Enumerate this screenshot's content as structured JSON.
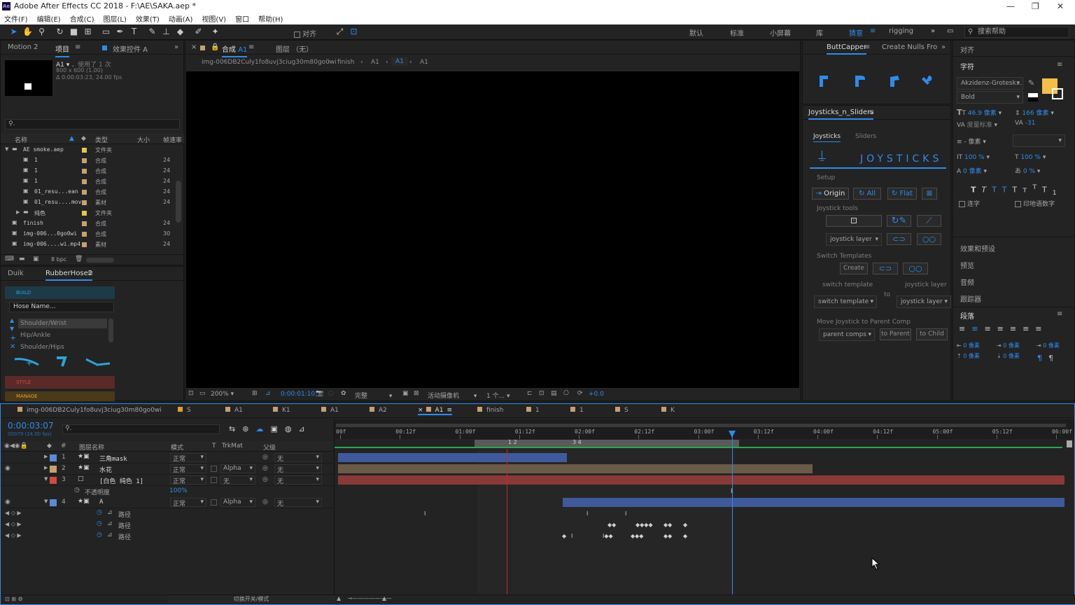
{
  "titlebar": {
    "title": "Adobe After Effects CC 2018 - F:\\AE\\SAKA.aep *",
    "logo": "Ae"
  },
  "menu": [
    "文件(F)",
    "编辑(E)",
    "合成(C)",
    "图层(L)",
    "效果(T)",
    "动画(A)",
    "视图(V)",
    "窗口",
    "帮助(H)"
  ],
  "toolbar": {
    "align_label": "对齐",
    "workspaces": [
      "默认",
      "标准",
      "小屏幕",
      "库",
      "猜意",
      "rigging"
    ],
    "active_workspace": "猜意",
    "search_placeholder": "搜索帮助"
  },
  "project": {
    "tabs": [
      "Motion 2",
      "项目",
      "效果控件 A"
    ],
    "comp_name": "A1",
    "used": "，使用了 1 次",
    "size": "800 x 600 (1.00)",
    "duration": "Δ 0:00:03:23, 24.00 fps",
    "columns": [
      "名称",
      "类型",
      "大小",
      "帧速率"
    ],
    "rows": [
      {
        "name": "AE smoke.aep",
        "type": "文件夹",
        "fps": "",
        "color": "#e0c84a",
        "indent": 0
      },
      {
        "name": "1",
        "type": "合成",
        "fps": "24",
        "color": "#c8a070",
        "indent": 1
      },
      {
        "name": "1",
        "type": "合成",
        "fps": "24",
        "color": "#c8a070",
        "indent": 1
      },
      {
        "name": "1",
        "type": "合成",
        "fps": "24",
        "color": "#c8a070",
        "indent": 1
      },
      {
        "name": "01_resu...ean",
        "type": "合成",
        "fps": "24",
        "color": "#c8a070",
        "indent": 1
      },
      {
        "name": "01_resu....mov",
        "type": "素材",
        "fps": "24",
        "color": "#c8a070",
        "indent": 1
      },
      {
        "name": "纯色",
        "type": "文件夹",
        "fps": "",
        "color": "#e0c84a",
        "indent": 1
      },
      {
        "name": "finish",
        "type": "合成",
        "fps": "24",
        "color": "#c8a070",
        "indent": 0
      },
      {
        "name": "img-006...0go0wi",
        "type": "合成",
        "fps": "30",
        "color": "#c8a070",
        "indent": 0
      },
      {
        "name": "img-006....wi.mp4",
        "type": "素材",
        "fps": "24",
        "color": "#c8a070",
        "indent": 0
      }
    ],
    "bpc": "8 bpc"
  },
  "rubberhose": {
    "tabs": [
      "Duik",
      "RubberHose2"
    ],
    "build": "BUILD",
    "hose_name": "Hose Name...",
    "items": [
      "Shoulder/Wrist",
      "Hip/Ankle",
      "Shoulder/Hips"
    ],
    "style": "STYLE",
    "manage": "MANAGE"
  },
  "composition": {
    "tab": "合成",
    "tab_comp": "A1",
    "layer_tab": "图层 （无）",
    "breadcrumbs": [
      "img-006DB2Culy1fo8uvj3ciug30m80go0wi",
      "finish",
      "A1",
      "A1",
      "A1"
    ],
    "footer": {
      "zoom": "200%",
      "time": "0:00:01:10",
      "quality": "完整",
      "camera": "活动摄像机",
      "views": "1 个...",
      "exposure": "+0.0"
    }
  },
  "buttcapper": {
    "tabs": [
      "ButtCapper",
      "Create Nulls Fro"
    ]
  },
  "joysticks": {
    "title": "Joysticks_n_Sliders",
    "tabs": [
      "Joysticks",
      "Sliders"
    ],
    "banner": "JOYSTICKS",
    "setup": "Setup",
    "setup_buttons": [
      "Origin",
      "All",
      "Flat"
    ],
    "tools": "Joystick tools",
    "joystick_layer": "joystick layer",
    "switch_templates": "Switch Templates",
    "create": "Create",
    "switch_template": "switch template",
    "to": "to",
    "joystick_layer2": "joystick layer",
    "move": "Move Joystick to Parent Comp",
    "parent_comps": "parent comps",
    "to_parent": "to Parent",
    "to_child": "to Child"
  },
  "char": {
    "tab_align": "对齐",
    "tab_char": "字符",
    "font": "Akzidenz-Grotesk...",
    "style": "Bold",
    "size": "46.9 像素",
    "leading": "166 像素",
    "kerning": "度量标准",
    "tracking": "-31",
    "unit": "- 像素",
    "vscale": "100 %",
    "hscale": "100 %",
    "baseline": "0 像素",
    "tsume": "0 %",
    "ligature": "连字",
    "hindi": "印地语数字",
    "fill_color": "#f2c048"
  },
  "sidepanels": [
    "效果和预设",
    "预览",
    "音频",
    "跟踪器"
  ],
  "para": {
    "title": "段落",
    "indents": [
      "0 像素",
      "0 像素",
      "0 像素",
      "0 像素",
      "0 像素"
    ]
  },
  "timeline": {
    "tabs": [
      "img-006DB2Culy1fo8uvj3ciug30m80go0wi",
      "S",
      "A1",
      "K1",
      "A1",
      "A2",
      "A1",
      "finish",
      "1",
      "1",
      "S",
      "K"
    ],
    "active_tab": "A1",
    "timecode": "0:00:03:07",
    "frameinfo": "00079 (24.00 fps)",
    "headers": [
      "#",
      "图层名称",
      "模式",
      "T",
      "TrkMat",
      "父级"
    ],
    "ruler": [
      "00f",
      "00:12f",
      "01:00f",
      "01:12f",
      "02:00f",
      "02:12f",
      "03:00f",
      "03:12f",
      "04:00f",
      "04:12f",
      "05:00f",
      "05:12f",
      "06:00f"
    ],
    "layers": [
      {
        "num": "1",
        "name": "三角mask",
        "mode": "正常",
        "trk": "",
        "parent": "无",
        "color": "#5a8ad8"
      },
      {
        "num": "2",
        "name": "水花",
        "mode": "正常",
        "trk": "Alpha",
        "parent": "无",
        "color": "#c8a070"
      },
      {
        "num": "3",
        "name": "[白色 纯色 1]",
        "mode": "正常",
        "trk": "无",
        "parent": "无",
        "color": "#d04a40"
      },
      {
        "num": "4",
        "name": "A",
        "mode": "正常",
        "trk": "Alpha",
        "parent": "无",
        "color": "#5a8ad8"
      }
    ],
    "opacity_label": "不透明度",
    "opacity_value": "100%",
    "path_label": "路径",
    "footer": "切换开关/模式"
  }
}
